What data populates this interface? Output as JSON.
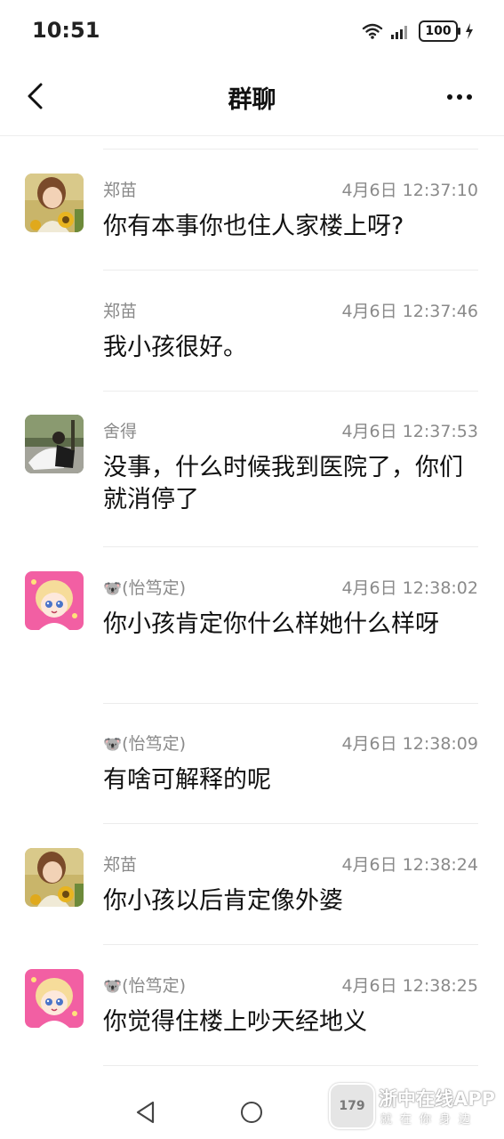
{
  "status_bar": {
    "time": "10:51",
    "battery": "100"
  },
  "header": {
    "title": "群聊"
  },
  "messages": [
    {
      "sender": "郑苗",
      "time": "4月6日 12:37:10",
      "text": "你有本事你也住人家楼上呀?",
      "avatar": "sunflower-girl"
    },
    {
      "sender": "郑苗",
      "time": "4月6日 12:37:46",
      "text": "我小孩很好。",
      "avatar": ""
    },
    {
      "sender": "舍得",
      "time": "4月6日 12:37:53",
      "text": "没事，什么时候我到医院了，你们就消停了",
      "avatar": "outdoor-photo"
    },
    {
      "sender": "(怡笃定)",
      "time": "4月6日 12:38:02",
      "text": "你小孩肯定你什么样她什么样呀",
      "avatar": "anime-girl",
      "emoji": "🐨"
    },
    {
      "sender": "(怡笃定)",
      "time": "4月6日 12:38:09",
      "text": "有啥可解释的呢",
      "avatar": "",
      "emoji": "🐨"
    },
    {
      "sender": "郑苗",
      "time": "4月6日 12:38:24",
      "text": "你小孩以后肯定像外婆",
      "avatar": "sunflower-girl"
    },
    {
      "sender": "(怡笃定)",
      "time": "4月6日 12:38:25",
      "text": "你觉得住楼上吵天经地义",
      "avatar": "anime-girl",
      "emoji": "🐨"
    }
  ],
  "watermark": {
    "title": "浙中在线APP",
    "subtitle": "就在你身边",
    "logo_text": "179"
  }
}
